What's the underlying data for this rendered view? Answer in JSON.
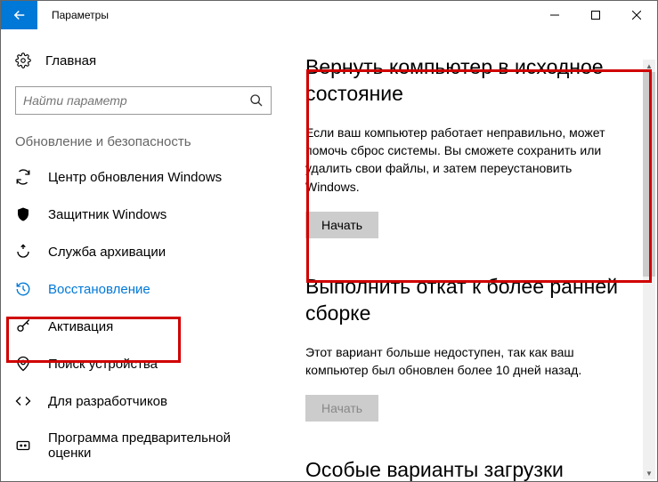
{
  "window": {
    "title": "Параметры"
  },
  "sidebar": {
    "home": "Главная",
    "search_placeholder": "Найти параметр",
    "section": "Обновление и безопасность",
    "items": [
      {
        "label": "Центр обновления Windows"
      },
      {
        "label": "Защитник Windows"
      },
      {
        "label": "Служба архивации"
      },
      {
        "label": "Восстановление"
      },
      {
        "label": "Активация"
      },
      {
        "label": "Поиск устройства"
      },
      {
        "label": "Для разработчиков"
      },
      {
        "label": "Программа предварительной оценки"
      }
    ]
  },
  "main": {
    "section1": {
      "title": "Вернуть компьютер в исходное состояние",
      "desc": "Если ваш компьютер работает неправильно, может помочь сброс системы. Вы сможете сохранить или удалить свои файлы, и затем переустановить Windows.",
      "button": "Начать"
    },
    "section2": {
      "title": "Выполнить откат к более ранней сборке",
      "desc": "Этот вариант больше недоступен, так как ваш компьютер был обновлен более 10 дней назад.",
      "button": "Начать"
    },
    "section3": {
      "title": "Особые варианты загрузки"
    }
  }
}
